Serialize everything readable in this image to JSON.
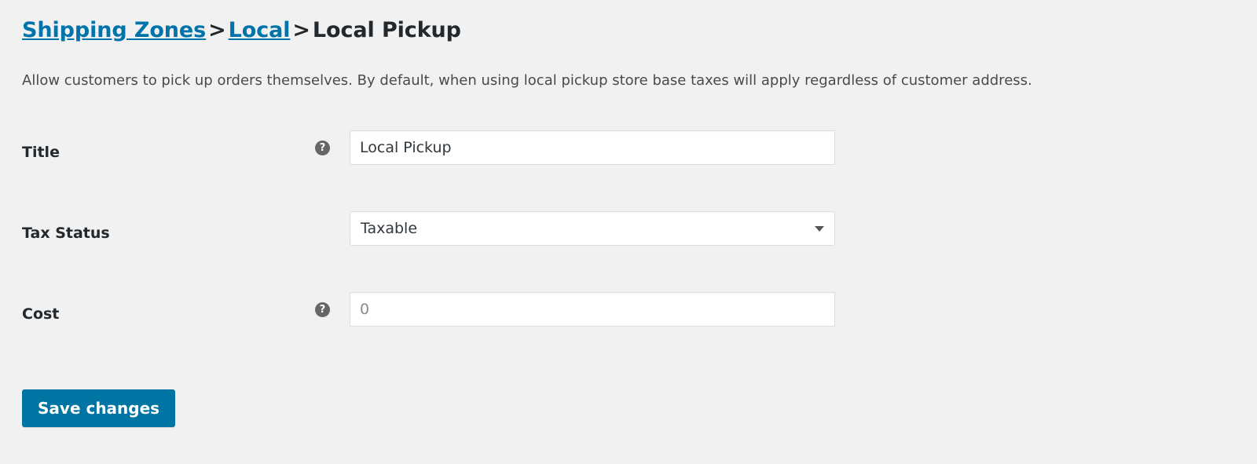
{
  "breadcrumb": {
    "items": [
      {
        "label": "Shipping Zones",
        "type": "link"
      },
      {
        "label": "Local",
        "type": "link"
      },
      {
        "label": "Local Pickup",
        "type": "current"
      }
    ],
    "separator": ">"
  },
  "description": "Allow customers to pick up orders themselves. By default, when using local pickup store base taxes will apply regardless of customer address.",
  "form": {
    "rows": [
      {
        "label": "Title",
        "has_help": true,
        "help_icon": "question-mark-icon",
        "help_glyph": "?",
        "control": "text",
        "value": "Local Pickup",
        "placeholder": ""
      },
      {
        "label": "Tax Status",
        "has_help": false,
        "help_icon": "",
        "help_glyph": "",
        "control": "select",
        "value": "Taxable",
        "placeholder": ""
      },
      {
        "label": "Cost",
        "has_help": true,
        "help_icon": "question-mark-icon",
        "help_glyph": "?",
        "control": "text",
        "value": "",
        "placeholder": "0"
      }
    ]
  },
  "actions": {
    "save_label": "Save changes"
  },
  "colors": {
    "background": "#f1f1f1",
    "link": "#0073aa",
    "primary_button": "#0074a2",
    "label_text": "#23282d",
    "body_text": "#4a4a4a",
    "field_border": "#dddddd",
    "help_circle": "#666666"
  }
}
